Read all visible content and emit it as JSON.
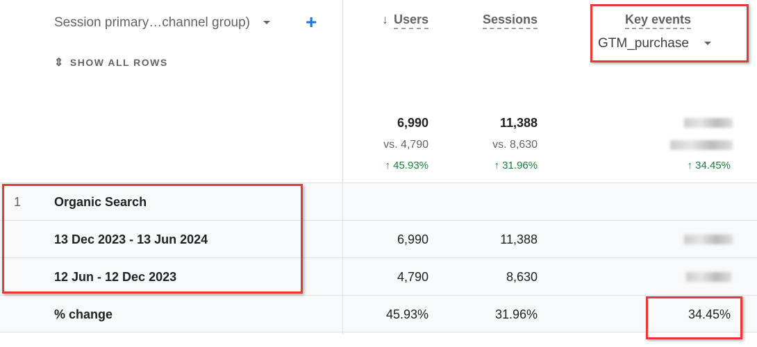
{
  "dimension": {
    "label": "Session primary…channel group)",
    "add": "+"
  },
  "show_all_rows": "SHOW ALL ROWS",
  "columns": [
    {
      "label": "Users",
      "sort": "↓"
    },
    {
      "label": "Sessions"
    },
    {
      "label": "Key events",
      "selector": "GTM_purchase"
    }
  ],
  "totals": {
    "users": {
      "value": "6,990",
      "vs": "vs. 4,790",
      "change": "↑ 45.93%"
    },
    "sessions": {
      "value": "11,388",
      "vs": "vs. 8,630",
      "change": "↑ 31.96%"
    },
    "key_events": {
      "change": "↑ 34.45%"
    }
  },
  "rows": [
    {
      "index": "1",
      "label": "Organic Search"
    },
    {
      "label": "13 Dec 2023 - 13 Jun 2024",
      "users": "6,990",
      "sessions": "11,388"
    },
    {
      "label": "12 Jun - 12 Dec 2023",
      "users": "4,790",
      "sessions": "8,630"
    },
    {
      "label": "% change",
      "users": "45.93%",
      "sessions": "31.96%",
      "key_events": "34.45%"
    }
  ],
  "colors": {
    "highlight": "#e53935",
    "accent": "#1a73e8",
    "positive": "#188038"
  }
}
